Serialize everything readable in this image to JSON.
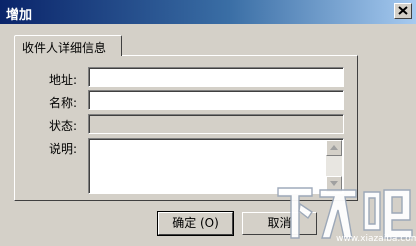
{
  "window": {
    "title": "增加"
  },
  "tab": {
    "label": "收件人详细信息"
  },
  "form": {
    "address_label": "地址:",
    "address_value": "",
    "name_label": "名称:",
    "name_value": "",
    "status_label": "状态:",
    "status_value": "",
    "description_label": "说明:",
    "description_value": ""
  },
  "buttons": {
    "ok_label": "确定 (O)",
    "cancel_label": "取消"
  },
  "watermark": {
    "logo": "下载吧",
    "url": "www.xiazaiba.com"
  },
  "colors": {
    "titlebar_start": "#0A246A",
    "titlebar_end": "#A6CAF0",
    "face": "#D4D0C8"
  },
  "icons": {
    "close": "close-icon",
    "scroll_up": "scroll-up-arrow-icon",
    "scroll_down": "scroll-down-arrow-icon"
  }
}
